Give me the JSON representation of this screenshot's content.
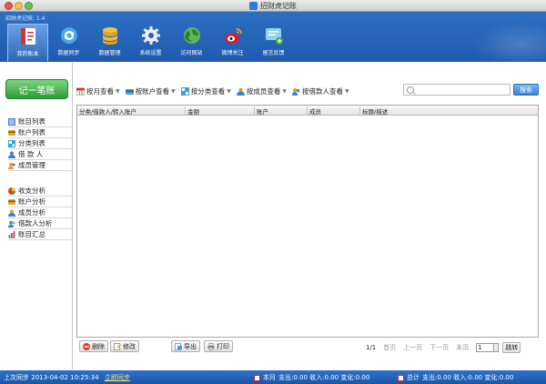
{
  "window": {
    "title": "招财虎记账"
  },
  "header": {
    "version": "招财虎记账: 1.4",
    "nav": [
      {
        "label": "我的账本",
        "icon": "ledger-icon",
        "active": true
      },
      {
        "label": "数据同步",
        "icon": "sync-icon",
        "active": false
      },
      {
        "label": "数据管理",
        "icon": "database-icon",
        "active": false
      },
      {
        "label": "系统设置",
        "icon": "gear-icon",
        "active": false
      },
      {
        "label": "访问网站",
        "icon": "globe-icon",
        "active": false
      },
      {
        "label": "微博关注",
        "icon": "weibo-icon",
        "active": false
      },
      {
        "label": "留言反馈",
        "icon": "feedback-icon",
        "active": false
      }
    ]
  },
  "sidebar": {
    "add_label": "记一笔账",
    "group1": [
      {
        "label": "账目列表",
        "icon": "list-icon"
      },
      {
        "label": "账户列表",
        "icon": "account-icon"
      },
      {
        "label": "分类列表",
        "icon": "category-icon"
      },
      {
        "label": "借 款 人",
        "icon": "borrower-icon"
      },
      {
        "label": "成员管理",
        "icon": "members-icon"
      }
    ],
    "group2": [
      {
        "label": "收支分析",
        "icon": "pie-icon"
      },
      {
        "label": "账户分析",
        "icon": "account-analysis-icon"
      },
      {
        "label": "成员分析",
        "icon": "member-analysis-icon"
      },
      {
        "label": "借款人分析",
        "icon": "borrower-analysis-icon"
      },
      {
        "label": "账目汇总",
        "icon": "summary-icon"
      }
    ]
  },
  "toolbar": {
    "items": [
      {
        "label": "按月查看",
        "icon": "calendar-icon"
      },
      {
        "label": "按账户查看",
        "icon": "account-view-icon"
      },
      {
        "label": "按分类查看",
        "icon": "category-view-icon"
      },
      {
        "label": "按成员查看",
        "icon": "member-view-icon"
      },
      {
        "label": "按借款人查看",
        "icon": "borrower-view-icon"
      }
    ],
    "search_placeholder": "",
    "search_button": "搜索"
  },
  "table": {
    "columns": [
      "分类/借款人/转入账户",
      "金额",
      "账户",
      "成员",
      "标题/描述"
    ]
  },
  "actions": {
    "delete": "删除",
    "edit": "修改",
    "export": "导出",
    "print": "打印"
  },
  "pager": {
    "page": "1/1",
    "first": "首页",
    "prev": "上一页",
    "next": "下一页",
    "last": "末页",
    "value": "1",
    "jump": "跳转"
  },
  "status": {
    "last_sync_label": "上次同步",
    "last_sync_time": "2013-04-02 10:25:34",
    "sync_now": "立即同步",
    "month_label": "本月",
    "month_stats": "支出:0.00 收入:0.00 变化:0.00",
    "total_label": "总计",
    "total_stats": "支出:0.00 收入:0.00 变化:0.00"
  }
}
